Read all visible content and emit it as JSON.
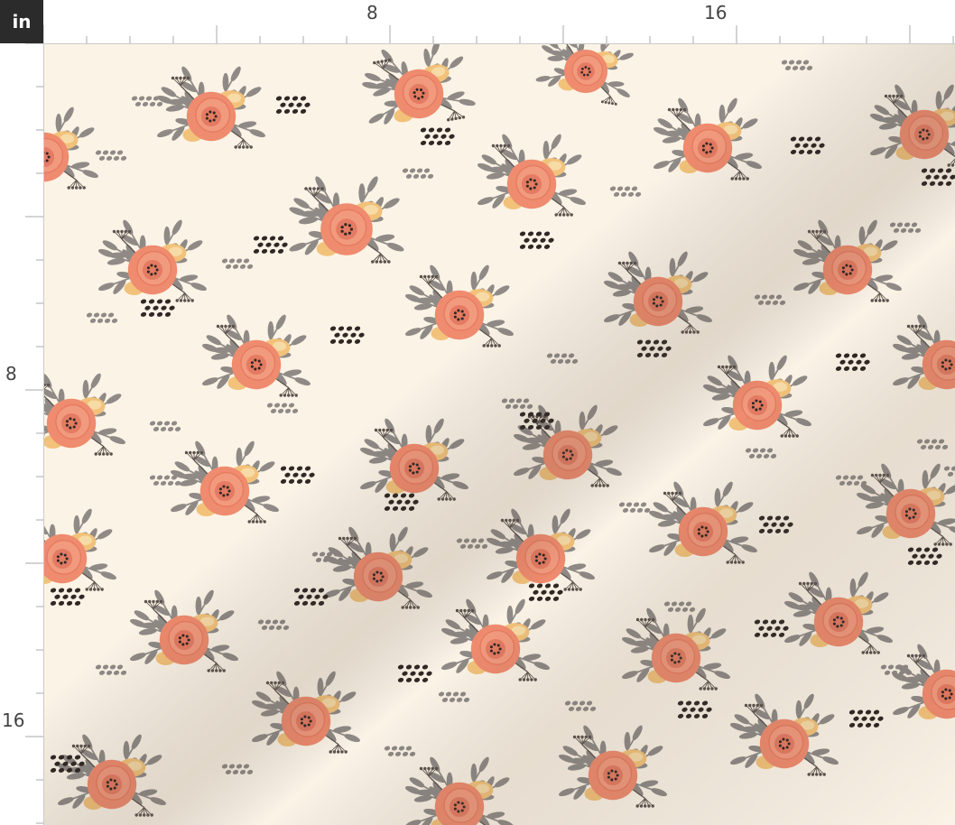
{
  "ruler": {
    "unit_label": "in",
    "top_labels": [
      "8",
      "16"
    ],
    "left_labels": [
      "8",
      "16"
    ]
  },
  "fabric": {
    "background_color": "#fbf3e6",
    "rose_color": "#ef8b6e",
    "rose_dark_color": "#d9634a",
    "petal_yellow_color": "#f2c27a",
    "leaf_color": "#8f8a86",
    "dot_dark_color": "#2f2825",
    "description_icons": [
      "rose-bouquet-icon",
      "dot-cluster-icon"
    ]
  }
}
